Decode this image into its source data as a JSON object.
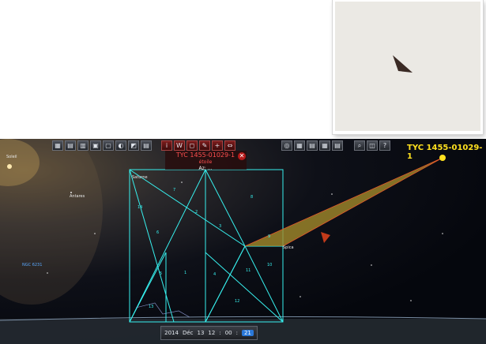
{
  "star": {
    "name": "TYC 1455-01029-1",
    "info_title": "TYC 1455-01029-1",
    "info_subtitle": "étoile",
    "info_line": "Az: ..."
  },
  "labels": {
    "soleil": "Soleil",
    "saturne": "Saturne",
    "antares": "Antares",
    "ngc": "NGC 6231",
    "spica": "Spica"
  },
  "zones": [
    "1",
    "2",
    "3",
    "4",
    "5",
    "6",
    "7",
    "8",
    "9",
    "10",
    "11",
    "12",
    "13",
    "14"
  ],
  "time": {
    "year": "2014",
    "month": "Déc",
    "day": "13",
    "hour": "12",
    "minute": "00",
    "second": "21"
  },
  "close_label": "✕",
  "toolbar_left": [
    "▦",
    "▤",
    "▥",
    "▣",
    "▢",
    "◐",
    "◩",
    "▤"
  ],
  "toolbar_mid": [
    "i",
    "W",
    "◻",
    "✎",
    "+",
    "⇔"
  ],
  "toolbar_right": [
    "◎",
    "▦",
    "▤",
    "▦",
    "▤",
    "⌕",
    "◫",
    "?"
  ],
  "colors": {
    "grid": "#37f0ee",
    "star": "#ffe11f",
    "accent": "#b61a1a",
    "wedge": "#a38a2a"
  }
}
